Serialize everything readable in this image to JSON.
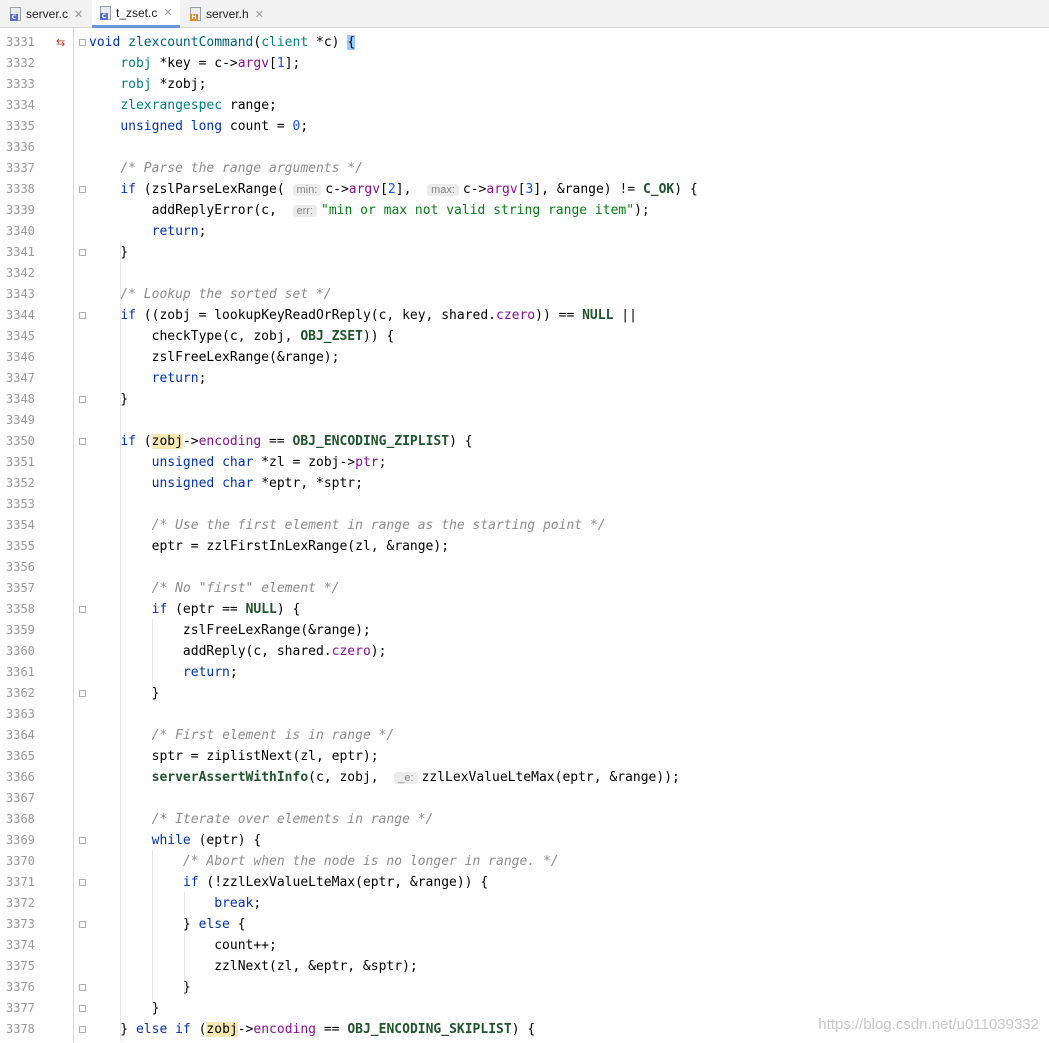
{
  "tabs": [
    {
      "label": "server.c",
      "icon": "c-file-icon"
    },
    {
      "label": "t_zset.c",
      "icon": "c-file-icon",
      "active": true
    },
    {
      "label": "server.h",
      "icon": "h-file-icon"
    }
  ],
  "line_numbers": [
    "3331",
    "3332",
    "3333",
    "3334",
    "3335",
    "3336",
    "3337",
    "3338",
    "3339",
    "3340",
    "3341",
    "3342",
    "3343",
    "3344",
    "3345",
    "3346",
    "3347",
    "3348",
    "3349",
    "3350",
    "3351",
    "3352",
    "3353",
    "3354",
    "3355",
    "3356",
    "3357",
    "3358",
    "3359",
    "3360",
    "3361",
    "3362",
    "3363",
    "3364",
    "3365",
    "3366",
    "3367",
    "3368",
    "3369",
    "3370",
    "3371",
    "3372",
    "3373",
    "3374",
    "3375",
    "3376",
    "3377",
    "3378"
  ],
  "hints": {
    "min": "min:",
    "max": "max:",
    "err": "err:",
    "e": "_e:"
  },
  "watermark": "https://blog.csdn.net/u011039332"
}
